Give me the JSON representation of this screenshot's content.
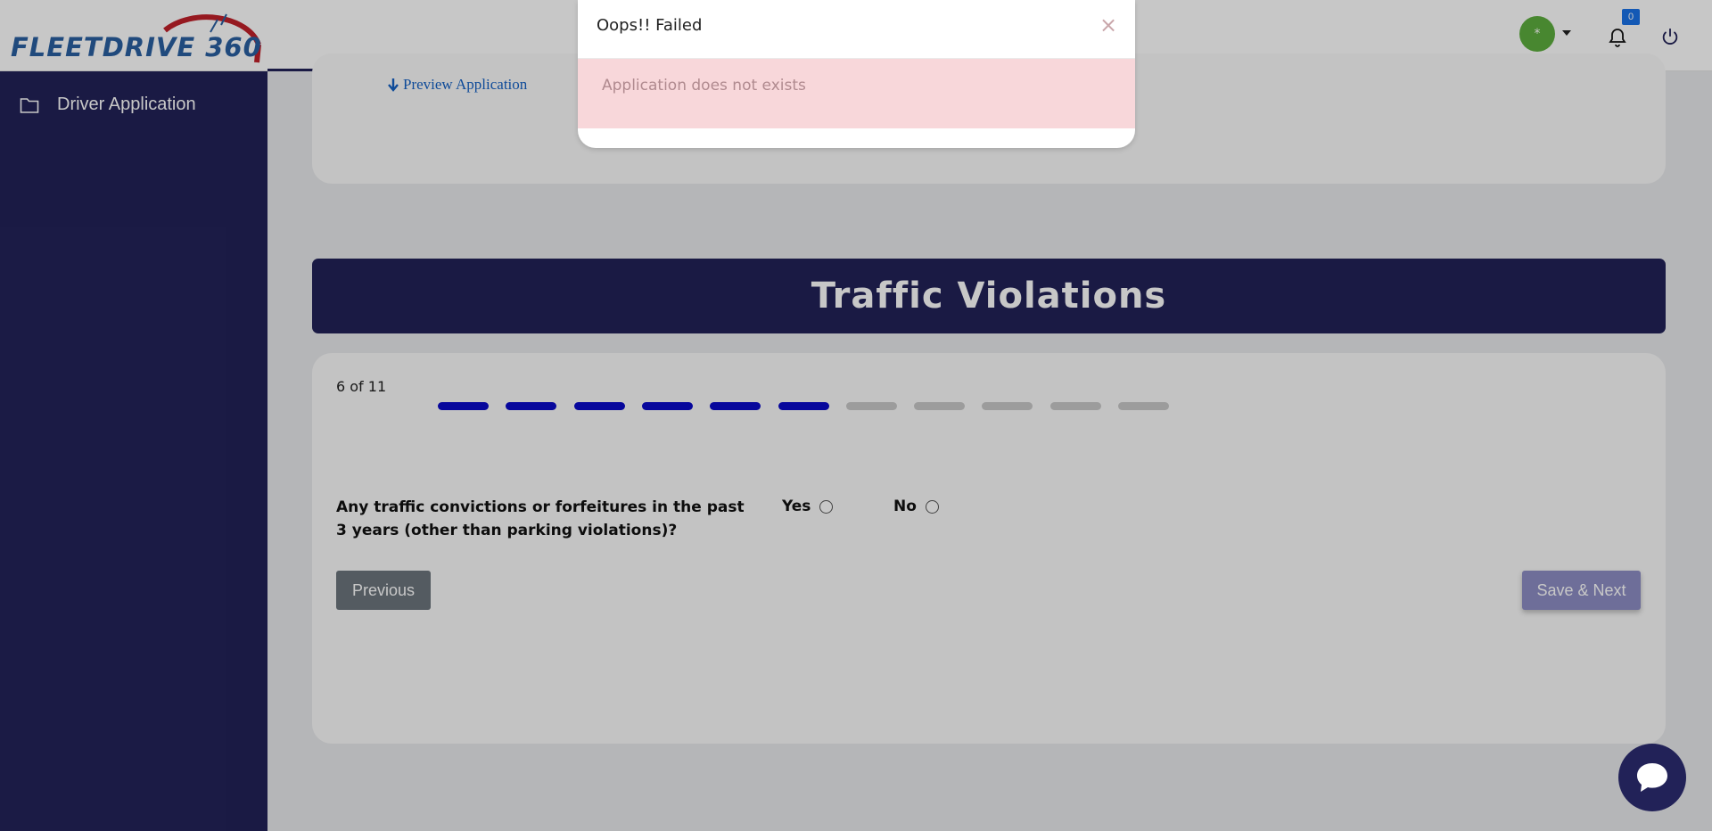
{
  "header": {
    "logo_text": "FLEETDRIVE 360",
    "avatar_text": "*",
    "notification_count": "0",
    "colors": {
      "brand_navy": "#222258",
      "logo_blue": "#2a5fa0",
      "logo_red": "#c0202a",
      "avatar_green": "#5dae3e",
      "badge_blue": "#1a73e8"
    }
  },
  "sidebar": {
    "items": [
      {
        "label": "Driver Application",
        "icon": "folder-icon"
      }
    ]
  },
  "top_card": {
    "preview_link": "Preview Application"
  },
  "section": {
    "title": "Traffic Violations"
  },
  "progress": {
    "label": "6 of 11",
    "current": 6,
    "total": 11,
    "active_color": "#0a0ac8",
    "inactive_color": "#c8c8c8"
  },
  "form": {
    "question": "Any traffic convictions or forfeitures in the past 3 years (other than parking violations)?",
    "options": [
      {
        "label": "Yes",
        "selected": false
      },
      {
        "label": "No",
        "selected": false
      }
    ],
    "previous_label": "Previous",
    "next_label": "Save & Next"
  },
  "modal": {
    "title": "Oops!! Failed",
    "close": "×",
    "message": "Application does not exists",
    "alert_color": "#f8d7da"
  }
}
